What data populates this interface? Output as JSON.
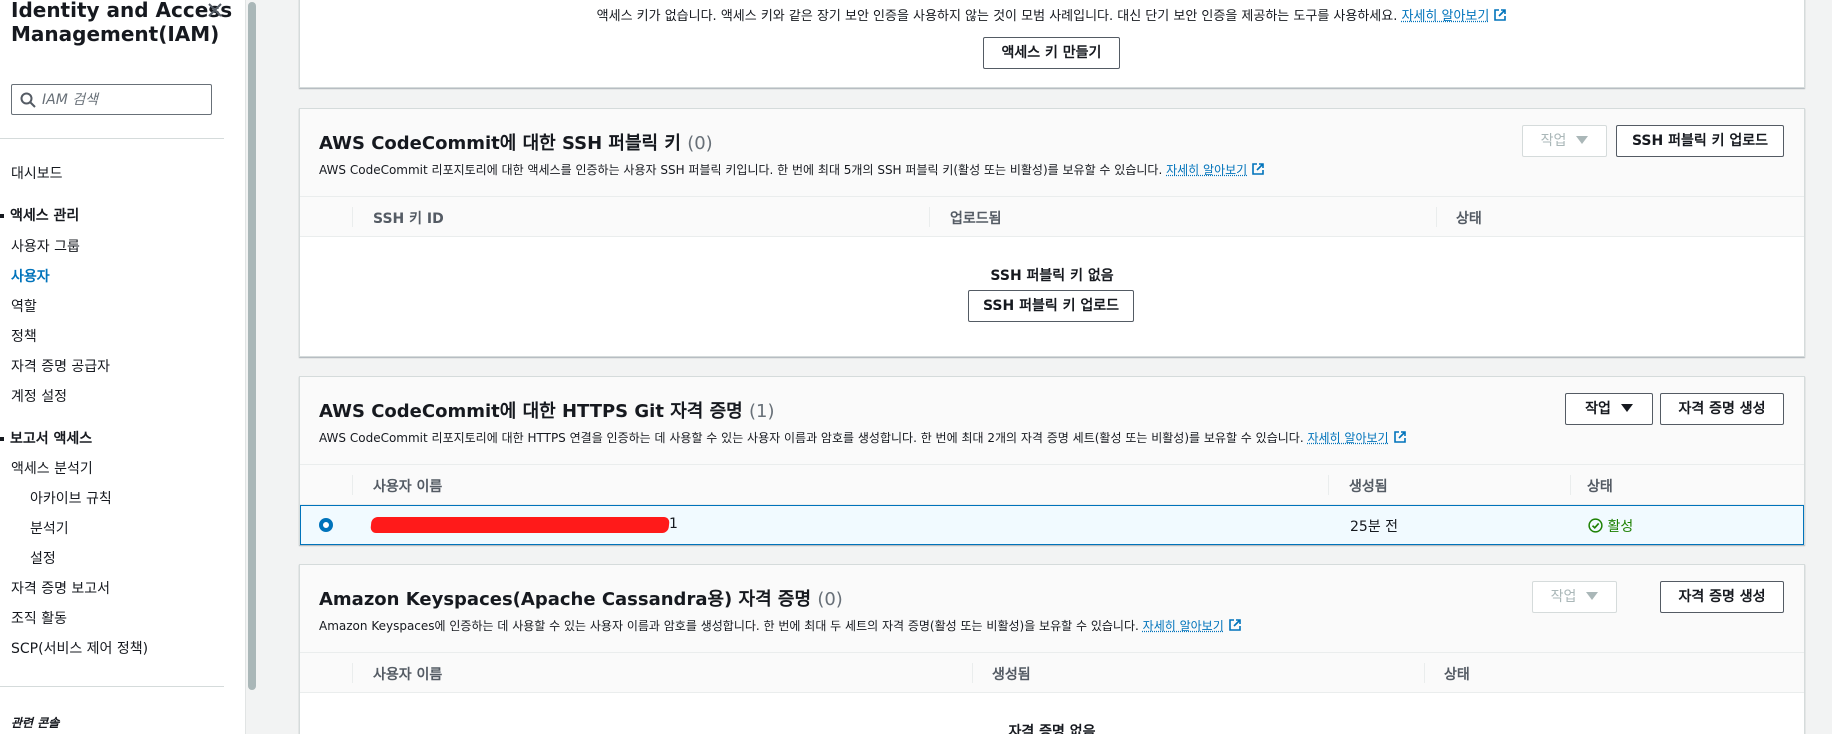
{
  "sidebar": {
    "title_line1": "Identity and Access",
    "title_line2": "Management(IAM)",
    "search_placeholder": "IAM 검색",
    "dashboard": "대시보드",
    "access_mgmt": {
      "heading": "액세스 관리",
      "items": [
        "사용자 그룹",
        "사용자",
        "역할",
        "정책",
        "자격 증명 공급자",
        "계정 설정"
      ],
      "active_index": 1
    },
    "reports": {
      "heading": "보고서 액세스",
      "analyzer": "액세스 분석기",
      "sub_items": [
        "아카이브 규칙",
        "분석기",
        "설정"
      ],
      "items": [
        "자격 증명 보고서",
        "조직 활동",
        "SCP(서비스 제어 정책)"
      ]
    },
    "related_console": "관련 콘솔"
  },
  "access_keys": {
    "description": "액세스 키가 없습니다. 액세스 키와 같은 장기 보안 인증을 사용하지 않는 것이 모범 사례입니다. 대신 단기 보안 인증을 제공하는 도구를 사용하세요.",
    "learn_more": "자세히 알아보기",
    "create_button": "액세스 키 만들기"
  },
  "ssh_keys": {
    "title": "AWS CodeCommit에 대한 SSH 퍼블릭 키",
    "count": "(0)",
    "description": "AWS CodeCommit 리포지토리에 대한 액세스를 인증하는 사용자 SSH 퍼블릭 키입니다. 한 번에 최대 5개의 SSH 퍼블릭 키(활성 또는 비활성)를 보유할 수 있습니다.",
    "learn_more": "자세히 알아보기",
    "actions_button": "작업",
    "upload_button": "SSH 퍼블릭 키 업로드",
    "columns": [
      "SSH 키 ID",
      "업로드됨",
      "상태"
    ],
    "empty_text": "SSH 퍼블릭 키 없음",
    "empty_upload_button": "SSH 퍼블릭 키 업로드"
  },
  "https_git": {
    "title": "AWS CodeCommit에 대한 HTTPS Git 자격 증명",
    "count": "(1)",
    "description": "AWS CodeCommit 리포지토리에 대한 HTTPS 연결을 인증하는 데 사용할 수 있는 사용자 이름과 암호를 생성합니다. 한 번에 최대 2개의 자격 증명 세트(활성 또는 비활성)를 보유할 수 있습니다.",
    "learn_more": "자세히 알아보기",
    "actions_button": "작업",
    "generate_button": "자격 증명 생성",
    "columns": [
      "사용자 이름",
      "생성됨",
      "상태"
    ],
    "rows": [
      {
        "username_suffix": "1",
        "created": "25분 전",
        "status": "활성"
      }
    ]
  },
  "keyspaces": {
    "title": "Amazon Keyspaces(Apache Cassandra용) 자격 증명",
    "count": "(0)",
    "description": "Amazon Keyspaces에 인증하는 데 사용할 수 있는 사용자 이름과 암호를 생성합니다. 한 번에 최대 두 세트의 자격 증명(활성 또는 비활성)을 보유할 수 있습니다.",
    "learn_more": "자세히 알아보기",
    "actions_button": "작업",
    "generate_button": "자격 증명 생성",
    "columns": [
      "사용자 이름",
      "생성됨",
      "상태"
    ],
    "empty_text": "자격 증명 없음"
  },
  "colors": {
    "link": "#0073bb",
    "success": "#1d8102",
    "redaction": "#ff1a1a"
  }
}
